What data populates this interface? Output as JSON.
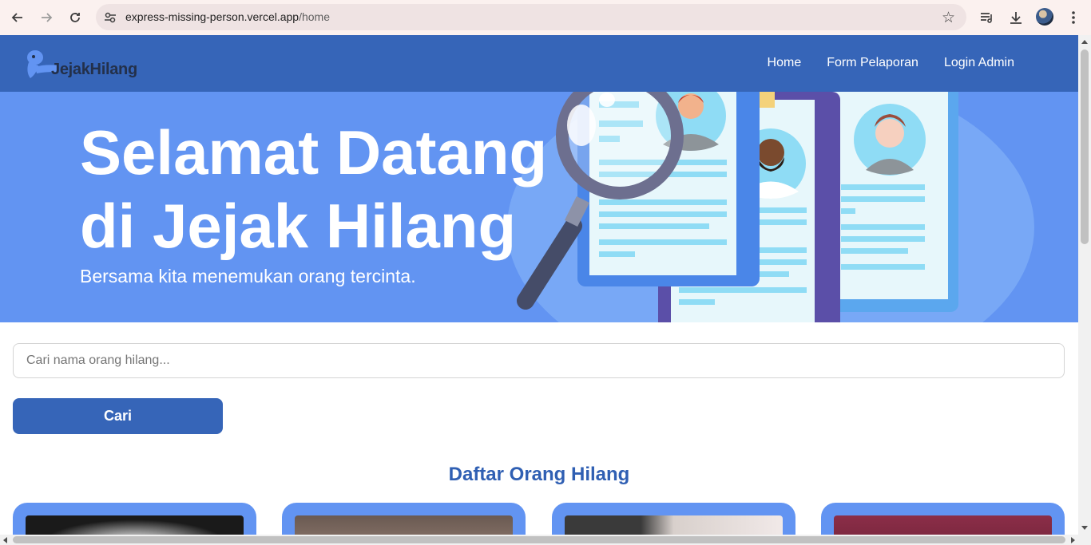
{
  "browser": {
    "url_host": "express-missing-person.vercel.app",
    "url_path": "/home",
    "icons": [
      "back-arrow-icon",
      "forward-arrow-icon",
      "reload-icon",
      "site-settings-icon",
      "bookmark-star-icon",
      "media-playlist-icon",
      "download-icon",
      "profile-avatar",
      "more-menu-icon"
    ]
  },
  "navbar": {
    "brand": "JejakHilang",
    "links": [
      "Home",
      "Form Pelaporan",
      "Login Admin"
    ]
  },
  "hero": {
    "title_line1": "Selamat Datang",
    "title_line2": "di Jejak Hilang",
    "subtitle": "Bersama kita menemukan orang tercinta."
  },
  "search": {
    "placeholder": "Cari nama orang hilang...",
    "button_label": "Cari"
  },
  "section": {
    "title": "Daftar Orang Hilang"
  },
  "colors": {
    "navbar": "#3665b8",
    "hero": "#6294f2",
    "title_text": "#2f5fb3"
  }
}
